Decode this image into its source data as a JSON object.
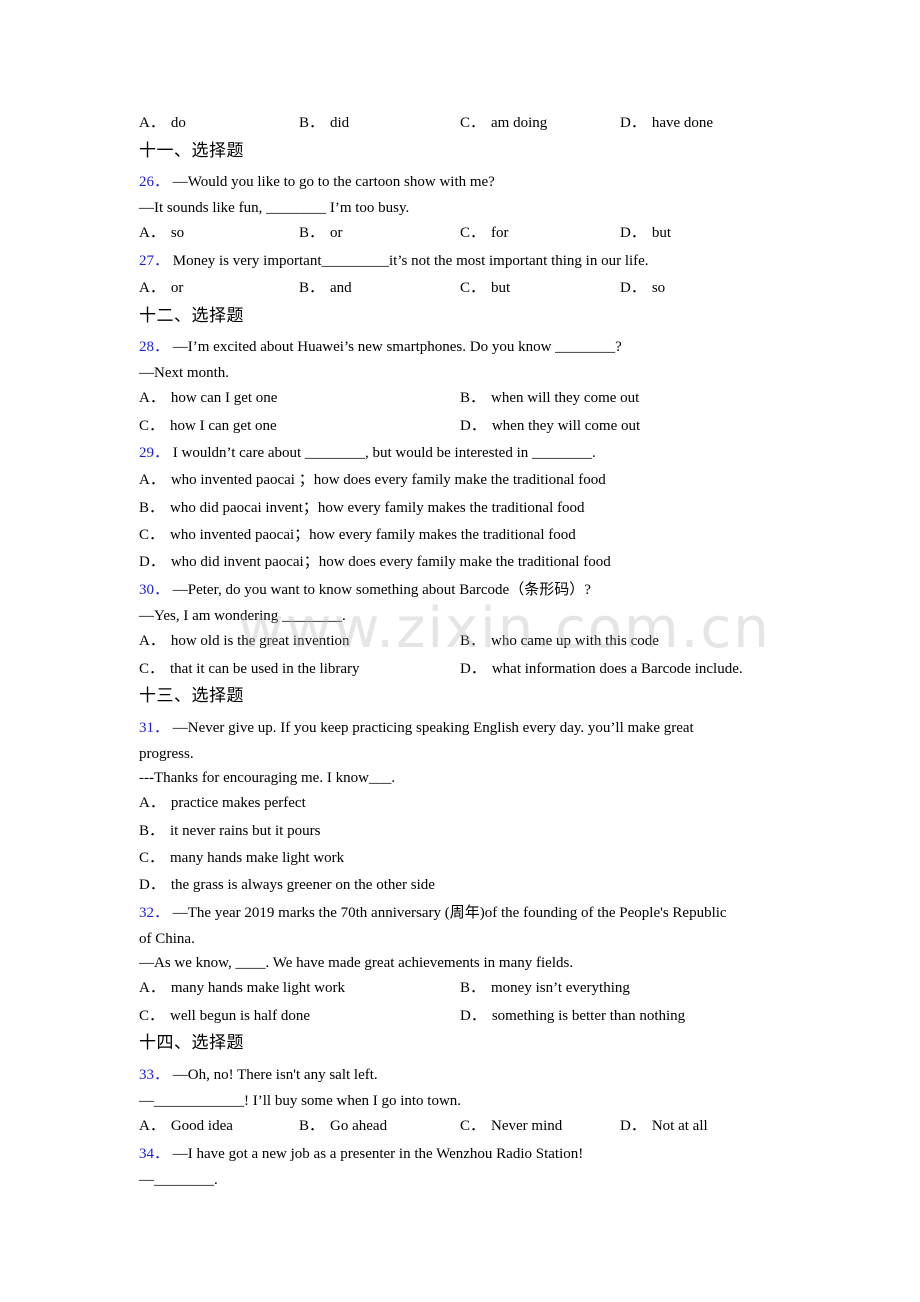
{
  "watermark": "www.zixin.com.cn",
  "prev_options": [
    {
      "label": "A．",
      "text": "do"
    },
    {
      "label": "B．",
      "text": "did"
    },
    {
      "label": "C．",
      "text": "am doing"
    },
    {
      "label": "D．",
      "text": "have done"
    }
  ],
  "sections": [
    {
      "title": "十一、选择题"
    },
    {
      "title": "十二、选择题"
    },
    {
      "title": "十三、选择题"
    },
    {
      "title": "十四、选择题"
    }
  ],
  "questions": {
    "q26": {
      "number": "26．",
      "lines": [
        "—Would you like to go to the cartoon show with me?",
        "—It sounds like fun, ________ I’m too busy."
      ],
      "options": [
        {
          "label": "A．",
          "text": "so"
        },
        {
          "label": "B．",
          "text": "or"
        },
        {
          "label": "C．",
          "text": "for"
        },
        {
          "label": "D．",
          "text": "but"
        }
      ]
    },
    "q27": {
      "number": "27．",
      "lines": [
        "Money is very important_________it’s not the most important thing in our life."
      ],
      "options": [
        {
          "label": "A．",
          "text": "or"
        },
        {
          "label": "B．",
          "text": "and"
        },
        {
          "label": "C．",
          "text": "but"
        },
        {
          "label": "D．",
          "text": "so"
        }
      ]
    },
    "q28": {
      "number": "28．",
      "lines": [
        "—I’m excited about Huawei’s new smartphones. Do you know ________?",
        "—Next month."
      ],
      "options": [
        {
          "label": "A．",
          "text": "how can I get one"
        },
        {
          "label": "B．",
          "text": "when will they come out"
        },
        {
          "label": "C．",
          "text": "how I can get one"
        },
        {
          "label": "D．",
          "text": "when they will come out"
        }
      ]
    },
    "q29": {
      "number": "29．",
      "lines": [
        "I wouldn’t care about ________, but would be interested in ________."
      ],
      "options": [
        {
          "label": "A．",
          "text": "who invented paocai ；how does every family make the traditional food"
        },
        {
          "label": "B．",
          "text": "who did paocai invent；how every family makes the traditional food"
        },
        {
          "label": "C．",
          "text": "who invented paocai；how every family makes the traditional food"
        },
        {
          "label": "D．",
          "text": "who did invent paocai；how does every family make the traditional food"
        }
      ]
    },
    "q30": {
      "number": "30．",
      "lines": [
        "—Peter, do you want to know something about Barcode（条形码）?",
        "—Yes, I am wondering ________."
      ],
      "options": [
        {
          "label": "A．",
          "text": "how old is the great invention"
        },
        {
          "label": "B．",
          "text": "who came up with this code"
        },
        {
          "label": "C．",
          "text": "that it can be used in the library"
        },
        {
          "label": "D．",
          "text": "what information does a Barcode include."
        }
      ]
    },
    "q31": {
      "number": "31．",
      "lines": [
        "—Never give up. If you keep practicing speaking English every day. you’ll make great",
        "progress.",
        "---Thanks for encouraging me. I know___."
      ],
      "options": [
        {
          "label": "A．",
          "text": "practice makes perfect"
        },
        {
          "label": "B．",
          "text": "it never rains but it pours"
        },
        {
          "label": "C．",
          "text": "many hands make light work"
        },
        {
          "label": "D．",
          "text": "the grass is always greener on the other side"
        }
      ]
    },
    "q32": {
      "number": "32．",
      "lines": [
        "—The year 2019 marks the 70th anniversary (周年)of the founding of the People's Republic",
        "of China.",
        "—As we know, ____. We have made great achievements in many fields."
      ],
      "options": [
        {
          "label": "A．",
          "text": "many hands make light work"
        },
        {
          "label": "B．",
          "text": "money isn’t everything"
        },
        {
          "label": "C．",
          "text": "well begun is half done"
        },
        {
          "label": "D．",
          "text": "something is better than nothing"
        }
      ]
    },
    "q33": {
      "number": "33．",
      "lines": [
        "—Oh, no! There isn't any salt left.",
        "—____________! I’ll buy some when I go into town."
      ],
      "options": [
        {
          "label": "A．",
          "text": "Good idea"
        },
        {
          "label": "B．",
          "text": "Go ahead"
        },
        {
          "label": "C．",
          "text": "Never mind"
        },
        {
          "label": "D．",
          "text": "Not at all"
        }
      ]
    },
    "q34": {
      "number": "34．",
      "lines": [
        "—I have got a new job as a presenter in the Wenzhou Radio Station!",
        "—________."
      ]
    }
  }
}
